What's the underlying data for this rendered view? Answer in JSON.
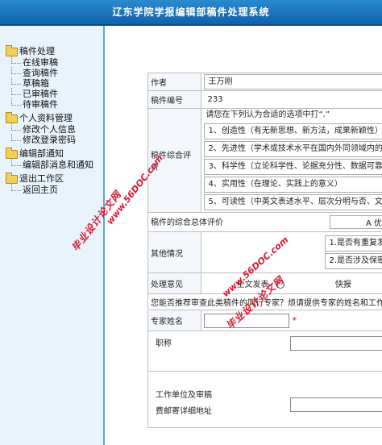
{
  "header": {
    "title": "辽东学院学报编辑部稿件处理系统"
  },
  "sidebar": {
    "groups": [
      {
        "label": "稿件处理",
        "items": [
          "在线审稿",
          "查询稿件",
          "草稿箱",
          "已审稿件",
          "待审稿件"
        ]
      },
      {
        "label": "个人资料管理",
        "items": [
          "修改个人信息",
          "修改登录密码"
        ]
      },
      {
        "label": "编辑部通知",
        "items": [
          "编辑部消息和通知"
        ]
      },
      {
        "label": "退出工作区",
        "items": [
          "返回主页"
        ]
      }
    ]
  },
  "form": {
    "author_label": "作者",
    "author_value": "王万刚",
    "number_label": "稿件编号",
    "number_value": "233",
    "eval_label": "稿件综合评价",
    "eval_prompt": "请您在下列认为合适的选项中打“.”",
    "eval_options": [
      "1、创造性（有无新思想、新方法，成果新颖性）",
      "2、先进性（学术或技术水平在国内外同领域内的",
      "3、科学性（立论科学性、论据充分性、数据可靠",
      "4、实用性（在理论、实践上的意义）",
      "5、可读性（中英文表述水平、层次分明与否、文"
    ],
    "overall_label": "稿件的综合总体评价",
    "overall_value": "A 优",
    "other_label": "其他情况",
    "other_items": [
      "1.是否有重复发",
      "2.是否涉及保密"
    ],
    "opinion_label": "处理意见",
    "opinion_options": [
      "全文发表",
      "快报"
    ],
    "recommend_text": "您能否推荐审查此类稿件的同行专家？烦请提供专家的姓名和工作",
    "expert_name_label": "专家姓名",
    "required_mark": "*",
    "title_label": "职称",
    "address_label_1": "工作单位及审稿",
    "address_label_2": "费邮寄详细地址"
  },
  "watermarks": [
    "www.56DOC.com",
    "毕业设计论文网"
  ]
}
